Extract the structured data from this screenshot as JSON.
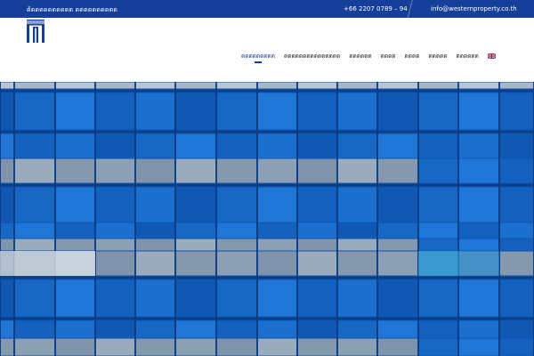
{
  "topbar": {
    "company_name": "ด้ดดดดดดดดดด ดดดดดดดดดด",
    "phone": "+66 2207 0789 – 94",
    "email": "info@westernproperty.co.th"
  },
  "header": {
    "logo_icon": "building-columns-logo-icon"
  },
  "nav": {
    "items": [
      {
        "label": "ดดดดดดดดด",
        "active": true
      },
      {
        "label": "ดดดดดดดดดดดดดดด",
        "active": false
      },
      {
        "label": "ดดดดดด",
        "active": false
      },
      {
        "label": "ดดดด",
        "active": false
      },
      {
        "label": "ดดดด",
        "active": false
      },
      {
        "label": "ดดดดด",
        "active": false
      },
      {
        "label": "ดดดดดด",
        "active": false
      }
    ],
    "language_icon": "uk-flag-icon"
  },
  "colors": {
    "brand_blue": "#153f9a",
    "hero_blue": "#1565c0",
    "panel_gray": "#8a9bb0"
  }
}
